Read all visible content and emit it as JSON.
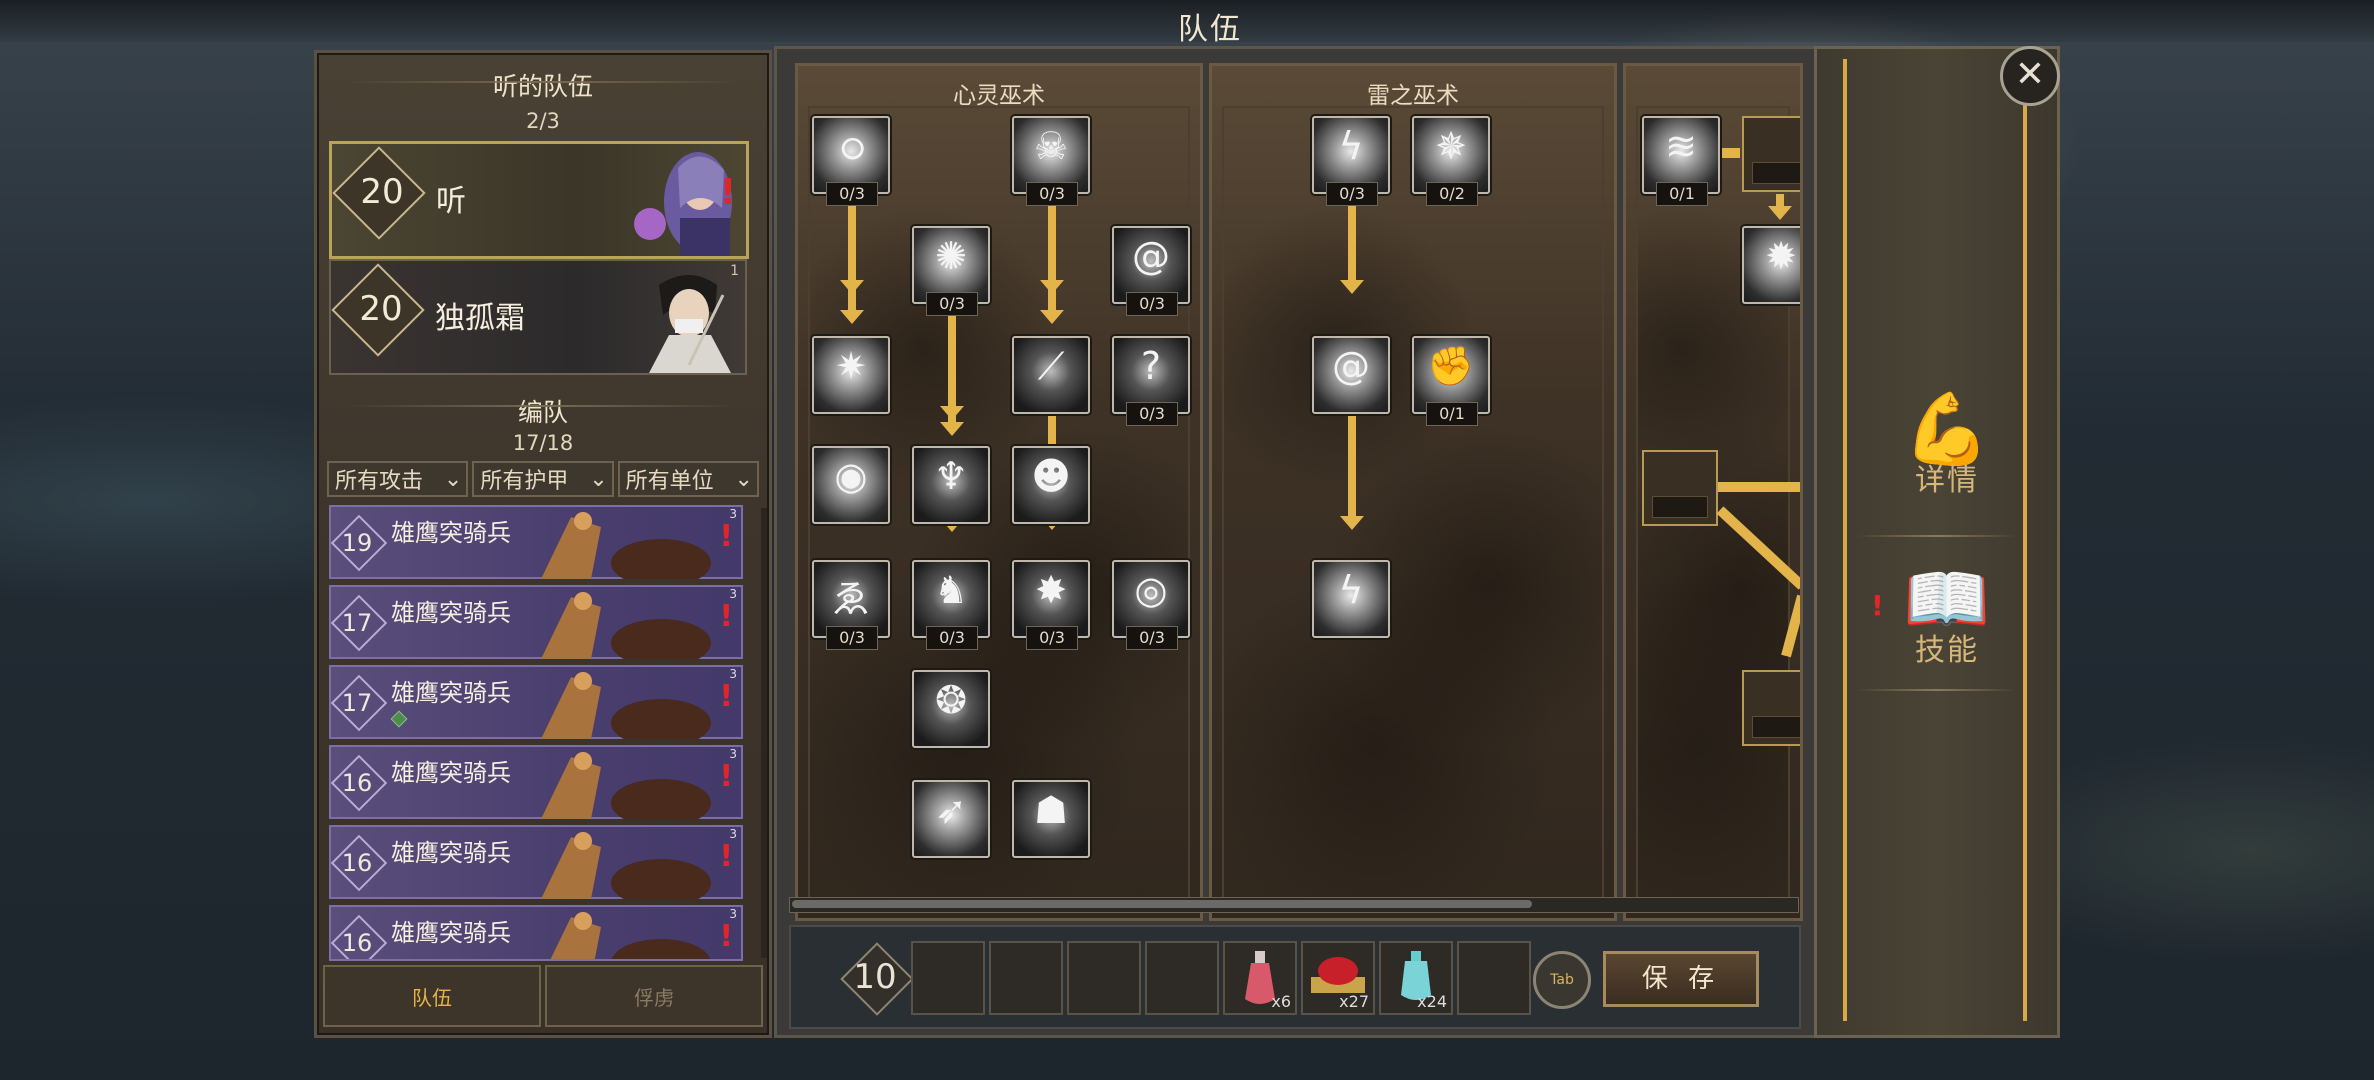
{
  "window_title": "队伍",
  "team": {
    "title": "听的队伍",
    "count": "2/3",
    "heroes": [
      {
        "level": "20",
        "name": "听",
        "selected": true,
        "badge": "!"
      },
      {
        "level": "20",
        "name": "独孤霜",
        "selected": false,
        "corner": "1"
      }
    ]
  },
  "formation": {
    "title": "编队",
    "count": "17/18",
    "filters": [
      "所有攻击",
      "所有护甲",
      "所有单位"
    ],
    "units": [
      {
        "level": "19",
        "name": "雄鹰突骑兵",
        "corner": "3",
        "alert": "!"
      },
      {
        "level": "17",
        "name": "雄鹰突骑兵",
        "corner": "3",
        "alert": "!"
      },
      {
        "level": "17",
        "name": "雄鹰突骑兵",
        "corner": "3",
        "alert": "!"
      },
      {
        "level": "16",
        "name": "雄鹰突骑兵",
        "corner": "3",
        "alert": "!"
      },
      {
        "level": "16",
        "name": "雄鹰突骑兵",
        "corner": "3",
        "alert": "!"
      },
      {
        "level": "16",
        "name": "雄鹰突骑兵",
        "corner": "3",
        "alert": "!"
      }
    ]
  },
  "bottom_tabs": {
    "team": "队伍",
    "prisoners": "俘虏"
  },
  "trees": {
    "mind": {
      "title": "心灵巫术",
      "skills": [
        {
          "icon": "swirl-smoke-icon",
          "count": "0/3"
        },
        {
          "icon": "demon-mask-icon",
          "count": "0/3"
        },
        {
          "icon": "light-burst-icon",
          "count": "0/3"
        },
        {
          "icon": "spiral-vortex-icon",
          "count": "0/3"
        },
        {
          "icon": "shatter-icon",
          "count": ""
        },
        {
          "icon": "slash-beam-icon",
          "count": ""
        },
        {
          "icon": "question-vines-icon",
          "count": "0/3"
        },
        {
          "icon": "glowing-orb-icon",
          "count": ""
        },
        {
          "icon": "dark-fiend-icon",
          "count": ""
        },
        {
          "icon": "grinning-monster-icon",
          "count": ""
        },
        {
          "icon": "ghost-icon",
          "count": "0/3"
        },
        {
          "icon": "spirit-bird-icon",
          "count": "0/3"
        },
        {
          "icon": "dark-star-icon",
          "count": "0/3"
        },
        {
          "icon": "eye-swirl-icon",
          "count": "0/3"
        },
        {
          "icon": "ring-crown-icon",
          "count": ""
        },
        {
          "icon": "spear-strike-icon",
          "count": ""
        },
        {
          "icon": "hooded-figure-icon",
          "count": ""
        }
      ]
    },
    "thunder": {
      "title": "雷之巫术",
      "skills": [
        {
          "icon": "lightning-icon",
          "count": "0/3"
        },
        {
          "icon": "shuriken-swirl-icon",
          "count": "0/2"
        },
        {
          "icon": "vortex-icon",
          "count": ""
        },
        {
          "icon": "sparkling-fist-icon",
          "count": "0/1"
        },
        {
          "icon": "lightning-bolt-icon",
          "count": ""
        }
      ]
    },
    "third": {
      "skills": [
        {
          "icon": "wind-slash-icon",
          "count": "0/1"
        },
        {
          "icon": "star-burst-icon",
          "count": ""
        }
      ]
    }
  },
  "bottom_bar": {
    "level": "10",
    "items": [
      {
        "icon": "red-potion-icon",
        "qty": "x6"
      },
      {
        "icon": "meat-platter-icon",
        "qty": "x27"
      },
      {
        "icon": "blue-potion-icon",
        "qty": "x24"
      }
    ],
    "tab_key": "Tab",
    "save": "保 存"
  },
  "right_panel": {
    "details": "详情",
    "skills": "技能",
    "skills_alert": "!"
  },
  "colors": {
    "accent_gold": "#e2b44a",
    "unit_purple": "#5a4e7c",
    "alert_red": "#e0262a"
  }
}
